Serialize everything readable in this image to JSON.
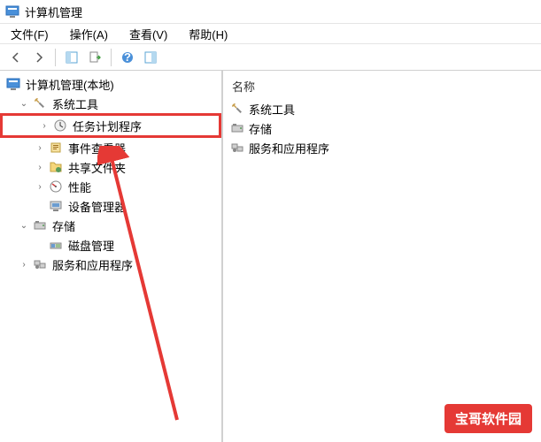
{
  "title": "计算机管理",
  "menu": {
    "file": "文件(F)",
    "action": "操作(A)",
    "view": "查看(V)",
    "help": "帮助(H)"
  },
  "tree": {
    "root": "计算机管理(本地)",
    "systemTools": "系统工具",
    "items": {
      "taskScheduler": "任务计划程序",
      "eventViewer": "事件查看器",
      "sharedFolders": "共享文件夹",
      "performance": "性能",
      "deviceManager": "设备管理器"
    },
    "storage": "存储",
    "diskMgmt": "磁盘管理",
    "services": "服务和应用程序"
  },
  "list": {
    "header": "名称",
    "items": {
      "systemTools": "系统工具",
      "storage": "存储",
      "services": "服务和应用程序"
    }
  },
  "watermark": "宝哥软件园"
}
